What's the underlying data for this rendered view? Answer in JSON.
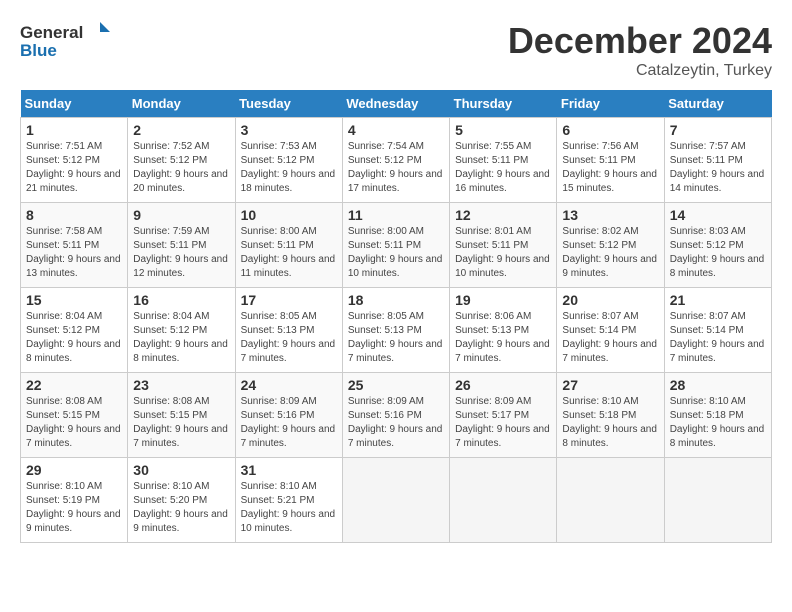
{
  "logo": {
    "general": "General",
    "blue": "Blue"
  },
  "header": {
    "month": "December 2024",
    "location": "Catalzeytin, Turkey"
  },
  "weekdays": [
    "Sunday",
    "Monday",
    "Tuesday",
    "Wednesday",
    "Thursday",
    "Friday",
    "Saturday"
  ],
  "weeks": [
    [
      {
        "day": "1",
        "rise": "Sunrise: 7:51 AM",
        "set": "Sunset: 5:12 PM",
        "daylight": "Daylight: 9 hours and 21 minutes."
      },
      {
        "day": "2",
        "rise": "Sunrise: 7:52 AM",
        "set": "Sunset: 5:12 PM",
        "daylight": "Daylight: 9 hours and 20 minutes."
      },
      {
        "day": "3",
        "rise": "Sunrise: 7:53 AM",
        "set": "Sunset: 5:12 PM",
        "daylight": "Daylight: 9 hours and 18 minutes."
      },
      {
        "day": "4",
        "rise": "Sunrise: 7:54 AM",
        "set": "Sunset: 5:12 PM",
        "daylight": "Daylight: 9 hours and 17 minutes."
      },
      {
        "day": "5",
        "rise": "Sunrise: 7:55 AM",
        "set": "Sunset: 5:11 PM",
        "daylight": "Daylight: 9 hours and 16 minutes."
      },
      {
        "day": "6",
        "rise": "Sunrise: 7:56 AM",
        "set": "Sunset: 5:11 PM",
        "daylight": "Daylight: 9 hours and 15 minutes."
      },
      {
        "day": "7",
        "rise": "Sunrise: 7:57 AM",
        "set": "Sunset: 5:11 PM",
        "daylight": "Daylight: 9 hours and 14 minutes."
      }
    ],
    [
      {
        "day": "8",
        "rise": "Sunrise: 7:58 AM",
        "set": "Sunset: 5:11 PM",
        "daylight": "Daylight: 9 hours and 13 minutes."
      },
      {
        "day": "9",
        "rise": "Sunrise: 7:59 AM",
        "set": "Sunset: 5:11 PM",
        "daylight": "Daylight: 9 hours and 12 minutes."
      },
      {
        "day": "10",
        "rise": "Sunrise: 8:00 AM",
        "set": "Sunset: 5:11 PM",
        "daylight": "Daylight: 9 hours and 11 minutes."
      },
      {
        "day": "11",
        "rise": "Sunrise: 8:00 AM",
        "set": "Sunset: 5:11 PM",
        "daylight": "Daylight: 9 hours and 10 minutes."
      },
      {
        "day": "12",
        "rise": "Sunrise: 8:01 AM",
        "set": "Sunset: 5:11 PM",
        "daylight": "Daylight: 9 hours and 10 minutes."
      },
      {
        "day": "13",
        "rise": "Sunrise: 8:02 AM",
        "set": "Sunset: 5:12 PM",
        "daylight": "Daylight: 9 hours and 9 minutes."
      },
      {
        "day": "14",
        "rise": "Sunrise: 8:03 AM",
        "set": "Sunset: 5:12 PM",
        "daylight": "Daylight: 9 hours and 8 minutes."
      }
    ],
    [
      {
        "day": "15",
        "rise": "Sunrise: 8:04 AM",
        "set": "Sunset: 5:12 PM",
        "daylight": "Daylight: 9 hours and 8 minutes."
      },
      {
        "day": "16",
        "rise": "Sunrise: 8:04 AM",
        "set": "Sunset: 5:12 PM",
        "daylight": "Daylight: 9 hours and 8 minutes."
      },
      {
        "day": "17",
        "rise": "Sunrise: 8:05 AM",
        "set": "Sunset: 5:13 PM",
        "daylight": "Daylight: 9 hours and 7 minutes."
      },
      {
        "day": "18",
        "rise": "Sunrise: 8:05 AM",
        "set": "Sunset: 5:13 PM",
        "daylight": "Daylight: 9 hours and 7 minutes."
      },
      {
        "day": "19",
        "rise": "Sunrise: 8:06 AM",
        "set": "Sunset: 5:13 PM",
        "daylight": "Daylight: 9 hours and 7 minutes."
      },
      {
        "day": "20",
        "rise": "Sunrise: 8:07 AM",
        "set": "Sunset: 5:14 PM",
        "daylight": "Daylight: 9 hours and 7 minutes."
      },
      {
        "day": "21",
        "rise": "Sunrise: 8:07 AM",
        "set": "Sunset: 5:14 PM",
        "daylight": "Daylight: 9 hours and 7 minutes."
      }
    ],
    [
      {
        "day": "22",
        "rise": "Sunrise: 8:08 AM",
        "set": "Sunset: 5:15 PM",
        "daylight": "Daylight: 9 hours and 7 minutes."
      },
      {
        "day": "23",
        "rise": "Sunrise: 8:08 AM",
        "set": "Sunset: 5:15 PM",
        "daylight": "Daylight: 9 hours and 7 minutes."
      },
      {
        "day": "24",
        "rise": "Sunrise: 8:09 AM",
        "set": "Sunset: 5:16 PM",
        "daylight": "Daylight: 9 hours and 7 minutes."
      },
      {
        "day": "25",
        "rise": "Sunrise: 8:09 AM",
        "set": "Sunset: 5:16 PM",
        "daylight": "Daylight: 9 hours and 7 minutes."
      },
      {
        "day": "26",
        "rise": "Sunrise: 8:09 AM",
        "set": "Sunset: 5:17 PM",
        "daylight": "Daylight: 9 hours and 7 minutes."
      },
      {
        "day": "27",
        "rise": "Sunrise: 8:10 AM",
        "set": "Sunset: 5:18 PM",
        "daylight": "Daylight: 9 hours and 8 minutes."
      },
      {
        "day": "28",
        "rise": "Sunrise: 8:10 AM",
        "set": "Sunset: 5:18 PM",
        "daylight": "Daylight: 9 hours and 8 minutes."
      }
    ],
    [
      {
        "day": "29",
        "rise": "Sunrise: 8:10 AM",
        "set": "Sunset: 5:19 PM",
        "daylight": "Daylight: 9 hours and 9 minutes."
      },
      {
        "day": "30",
        "rise": "Sunrise: 8:10 AM",
        "set": "Sunset: 5:20 PM",
        "daylight": "Daylight: 9 hours and 9 minutes."
      },
      {
        "day": "31",
        "rise": "Sunrise: 8:10 AM",
        "set": "Sunset: 5:21 PM",
        "daylight": "Daylight: 9 hours and 10 minutes."
      },
      null,
      null,
      null,
      null
    ]
  ]
}
